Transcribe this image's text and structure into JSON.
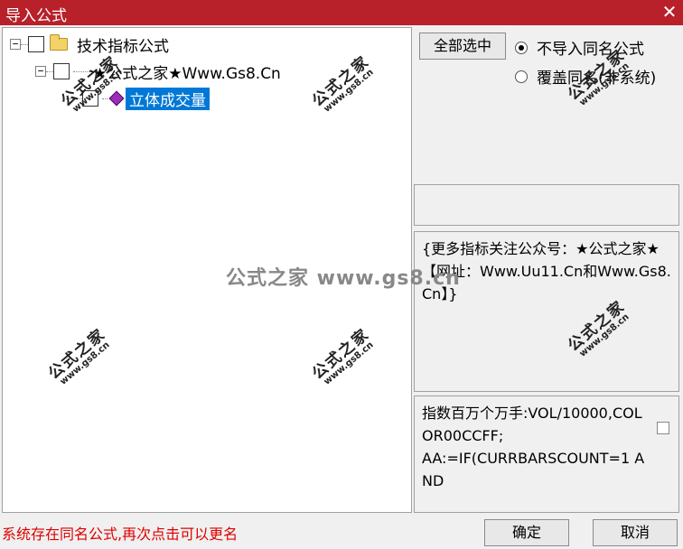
{
  "window": {
    "title": "导入公式",
    "close_glyph": "✕"
  },
  "tree": {
    "root": {
      "expander": "⊟",
      "label": "技术指标公式"
    },
    "child": {
      "expander": "⊟",
      "label": "★公式之家★Www.Gs8.Cn"
    },
    "leaf": {
      "label": "立体成交量",
      "selected": true
    }
  },
  "options": {
    "select_all_label": "全部选中",
    "radio_no_import": {
      "label": "不导入同名公式",
      "checked": true
    },
    "radio_overwrite": {
      "label": "覆盖同名(非系统)",
      "checked": false
    }
  },
  "description": "{更多指标关注公众号：★公式之家★【网址：Www.Uu11.Cn和Www.Gs8.Cn】}",
  "formula_code": "指数百万个万手:VOL/10000,COLOR00CCFF;\nAA:=IF(CURRBARSCOUNT=1 AND",
  "watermark": {
    "text_cn": "公式之家",
    "text_url": "www.gs8.cn",
    "center_text": "公式之家 www.gs8.cn"
  },
  "status_message": "系统存在同名公式,再次点击可以更名",
  "buttons": {
    "ok_label": "确定",
    "cancel_label": "取消"
  },
  "colors": {
    "titlebar": "#b8202a",
    "status_text": "#e00000",
    "selection": "#0078d7"
  }
}
